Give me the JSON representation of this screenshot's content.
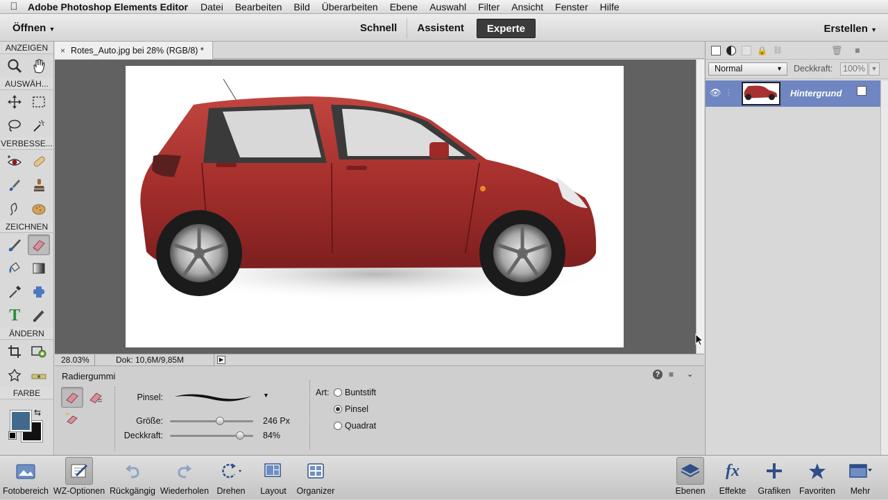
{
  "menubar": {
    "app": "Adobe Photoshop Elements Editor",
    "items": [
      "Datei",
      "Bearbeiten",
      "Bild",
      "Überarbeiten",
      "Ebene",
      "Auswahl",
      "Filter",
      "Ansicht",
      "Fenster",
      "Hilfe"
    ]
  },
  "topbar": {
    "open": "Öffnen",
    "modes": [
      "Schnell",
      "Assistent",
      "Experte"
    ],
    "active_mode": "Experte",
    "create": "Erstellen"
  },
  "toolbox": {
    "sections": [
      "ANZEIGEN",
      "AUSWÄH...",
      "VERBESSE...",
      "ZEICHNEN",
      "ÄNDERN",
      "FARBE"
    ],
    "foreground_color": "#3f6a8e",
    "background_color": "#111111"
  },
  "document": {
    "tab": "Rotes_Auto.jpg bei 28% (RGB/8) *",
    "zoom": "28.03%",
    "doc_size": "Dok: 10,6M/9,85M"
  },
  "options": {
    "title": "Radiergummi",
    "brush_label": "Pinsel:",
    "size_label": "Größe:",
    "size_value": "246 Px",
    "size_level": 0.6,
    "opacity_label": "Deckkraft:",
    "opacity_value": "84%",
    "opacity_level": 0.84,
    "type_label": "Art:",
    "types": [
      "Buntstift",
      "Pinsel",
      "Quadrat"
    ],
    "selected_type": "Pinsel"
  },
  "layers": {
    "blend_mode": "Normal",
    "opacity_label": "Deckkraft:",
    "opacity_value": "100%",
    "layer_name": "Hintergrund",
    "highlight_color": "#6f86c2"
  },
  "bottombar": {
    "left": [
      "Fotobereich",
      "WZ-Optionen",
      "Rückgängig",
      "Wiederholen",
      "Drehen",
      "Layout",
      "Organizer"
    ],
    "right": [
      "Ebenen",
      "Effekte",
      "Grafiken",
      "Favoriten",
      "Mehr"
    ]
  }
}
